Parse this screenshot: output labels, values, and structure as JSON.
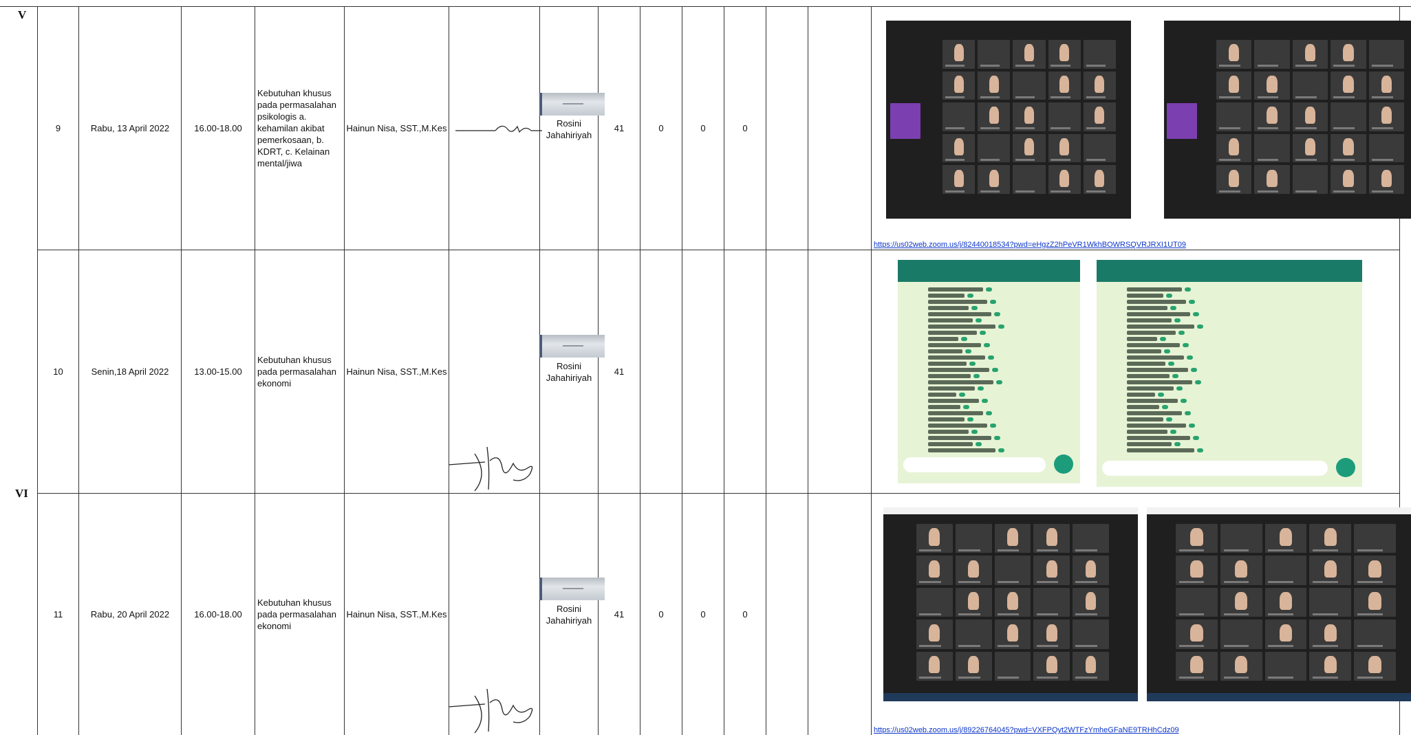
{
  "sections": [
    {
      "numeral": "V"
    },
    {
      "numeral": "VI"
    }
  ],
  "rows": [
    {
      "no": "9",
      "date": "Rabu, 13 April 2022",
      "time": "16.00-18.00",
      "topic": "Kebutuhan khusus pada permasalahan psikologis a. kehamilan akibat pemerkosaan, b. KDRT, c. Kelainan mental/jiwa",
      "lecturer": "Hainun Nisa, SST.,M.Kes",
      "facilitator": "Rosini Jahahiriyah",
      "count": "41",
      "col_a": "0",
      "col_b": "0",
      "col_c": "0",
      "evidence_type": "zoom-screenshot",
      "link": "https://us02web.zoom.us/j/82440018534?pwd=eHgzZ2hPeVR1WkhBOWRSQVRJRXI1UT09"
    },
    {
      "no": "10",
      "date": "Senin,18 April 2022",
      "time": "13.00-15.00",
      "topic": "Kebutuhan khusus pada permasalahan ekonomi",
      "lecturer": "Hainun Nisa, SST.,M.Kes",
      "facilitator": "Rosini Jahahiriyah",
      "count": "41",
      "col_a": "",
      "col_b": "",
      "col_c": "",
      "evidence_type": "whatsapp-screenshot",
      "link": ""
    },
    {
      "no": "11",
      "date": "Rabu, 20 April 2022",
      "time": "16.00-18.00",
      "topic": "Kebutuhan khusus pada permasalahan ekonomi",
      "lecturer": "Hainun Nisa, SST.,M.Kes",
      "facilitator": "Rosini Jahahiriyah",
      "count": "41",
      "col_a": "0",
      "col_b": "0",
      "col_c": "0",
      "evidence_type": "zoom-screenshot",
      "link": "https://us02web.zoom.us/j/89226764045?pwd=VXFPQyt2WTFzYmheGFaNE9TRHhCdz09"
    }
  ],
  "colors": {
    "link": "#0b35c9",
    "zoom_bg": "#1f1f1f",
    "whatsapp_bg": "#e7f3d5",
    "whatsapp_bar": "#1a7a68"
  }
}
